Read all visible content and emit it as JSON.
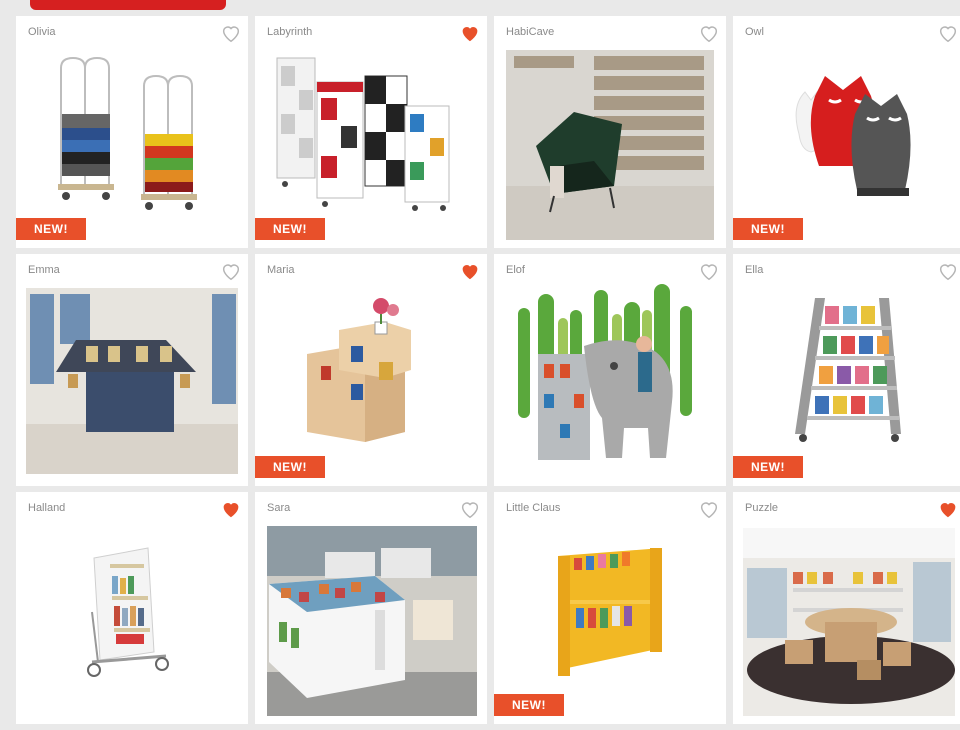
{
  "colors": {
    "accent": "#e8502a",
    "heart_filled": "#e8502a",
    "heart_outline": "#b5b5b5"
  },
  "products": [
    {
      "name": "Olivia",
      "favorite": false,
      "new": true,
      "badge": "NEW!"
    },
    {
      "name": "Labyrinth",
      "favorite": true,
      "new": true,
      "badge": "NEW!"
    },
    {
      "name": "HabiCave",
      "favorite": false,
      "new": false
    },
    {
      "name": "Owl",
      "favorite": false,
      "new": true,
      "badge": "NEW!"
    },
    {
      "name": "Emma",
      "favorite": false,
      "new": false
    },
    {
      "name": "Maria",
      "favorite": true,
      "new": true,
      "badge": "NEW!"
    },
    {
      "name": "Elof",
      "favorite": false,
      "new": false
    },
    {
      "name": "Ella",
      "favorite": false,
      "new": true,
      "badge": "NEW!"
    },
    {
      "name": "Halland",
      "favorite": true,
      "new": false
    },
    {
      "name": "Sara",
      "favorite": false,
      "new": false
    },
    {
      "name": "Little Claus",
      "favorite": false,
      "new": true,
      "badge": "NEW!"
    },
    {
      "name": "Puzzle",
      "favorite": true,
      "new": false
    }
  ]
}
